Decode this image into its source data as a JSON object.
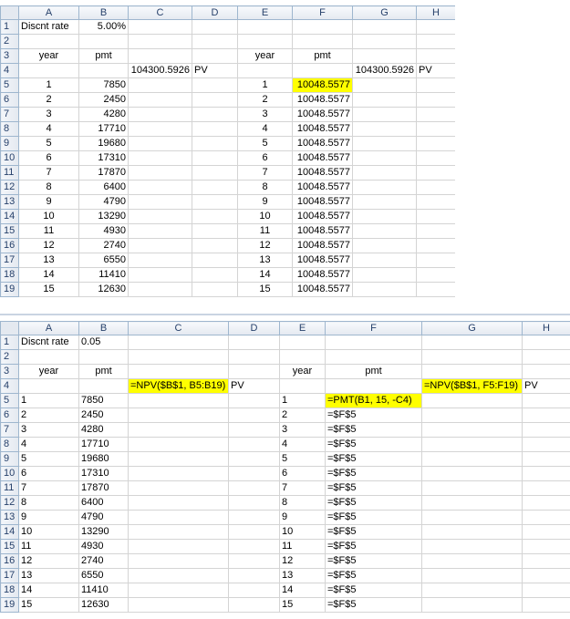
{
  "values_sheet": {
    "columns": [
      "A",
      "B",
      "C",
      "D",
      "E",
      "F",
      "G",
      "H"
    ],
    "row_numbers": [
      "1",
      "2",
      "3",
      "4",
      "5",
      "6",
      "7",
      "8",
      "9",
      "10",
      "11",
      "12",
      "13",
      "14",
      "15",
      "16",
      "17",
      "18",
      "19"
    ],
    "row1": {
      "label": "Discnt rate",
      "rate": "5.00%"
    },
    "row3": {
      "year_left": "year",
      "pmt_left": "pmt",
      "year_right": "year",
      "pmt_right": "pmt"
    },
    "row4": {
      "npv_left": "104300.5926",
      "pv_left": "PV",
      "npv_right": "104300.5926",
      "pv_right": "PV"
    },
    "years": [
      "1",
      "2",
      "3",
      "4",
      "5",
      "6",
      "7",
      "8",
      "9",
      "10",
      "11",
      "12",
      "13",
      "14",
      "15"
    ],
    "pmts": [
      "7850",
      "2450",
      "4280",
      "17710",
      "19680",
      "17310",
      "17870",
      "6400",
      "4790",
      "13290",
      "4930",
      "2740",
      "6550",
      "11410",
      "12630"
    ],
    "level_pmt": "10048.5577"
  },
  "formulas_sheet": {
    "columns": [
      "A",
      "B",
      "C",
      "D",
      "E",
      "F",
      "G",
      "H"
    ],
    "row_numbers": [
      "1",
      "2",
      "3",
      "4",
      "5",
      "6",
      "7",
      "8",
      "9",
      "10",
      "11",
      "12",
      "13",
      "14",
      "15",
      "16",
      "17",
      "18",
      "19"
    ],
    "row1": {
      "label": "Discnt rate",
      "rate": "0.05"
    },
    "row3": {
      "year_left": "year",
      "pmt_left": "pmt",
      "year_right": "year",
      "pmt_right": "pmt"
    },
    "row4": {
      "npv_left": "=NPV($B$1, B5:B19)",
      "pv_left": "PV",
      "npv_right": "=NPV($B$1, F5:F19)",
      "pv_right": "PV"
    },
    "pmt_formula": "=PMT(B1, 15, -C4)",
    "ref_formula": "=$F$5"
  },
  "colors": {
    "highlight": "#ffff00",
    "header_bg": "#e4e9f0",
    "grid": "#d4d4d4"
  }
}
